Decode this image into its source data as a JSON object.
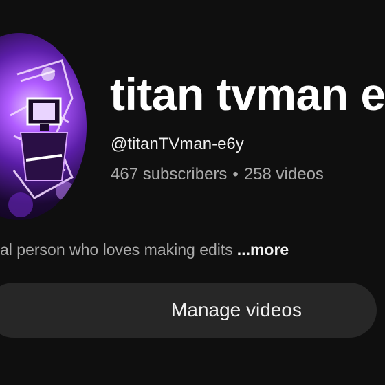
{
  "channel": {
    "name": "titan tvman e",
    "handle": "@titanTVman-e6y",
    "subscribers": "467 subscribers",
    "separator": "•",
    "videos": "258 videos"
  },
  "description": {
    "text": "al person who loves making edits",
    "more_label": "...more"
  },
  "actions": {
    "manage_videos_label": "Manage videos"
  },
  "colors": {
    "background": "#0f0f0f",
    "button_bg": "#272727",
    "secondary_text": "#aaaaaa",
    "avatar_accent": "#b05cff"
  }
}
